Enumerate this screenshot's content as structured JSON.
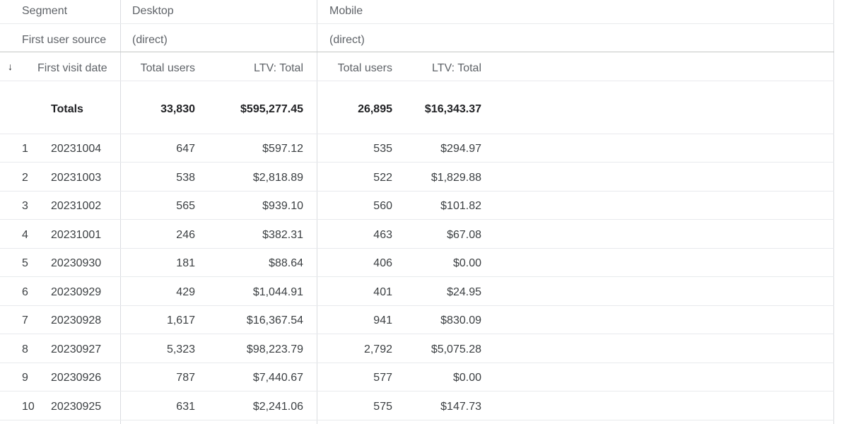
{
  "segment_row": {
    "label": "Segment",
    "desktop": "Desktop",
    "mobile": "Mobile"
  },
  "source_row": {
    "label": "First user source",
    "desktop": "(direct)",
    "mobile": "(direct)"
  },
  "header": {
    "sort_icon": "arrow-down-icon",
    "dimension": "First visit date",
    "desktop_users": "Total users",
    "desktop_ltv": "LTV: Total",
    "mobile_users": "Total users",
    "mobile_ltv": "LTV: Total"
  },
  "totals": {
    "label": "Totals",
    "desktop_users": "33,830",
    "desktop_ltv": "$595,277.45",
    "mobile_users": "26,895",
    "mobile_ltv": "$16,343.37"
  },
  "rows": [
    {
      "idx": "1",
      "date": "20231004",
      "d_users": "647",
      "d_ltv": "$597.12",
      "m_users": "535",
      "m_ltv": "$294.97"
    },
    {
      "idx": "2",
      "date": "20231003",
      "d_users": "538",
      "d_ltv": "$2,818.89",
      "m_users": "522",
      "m_ltv": "$1,829.88"
    },
    {
      "idx": "3",
      "date": "20231002",
      "d_users": "565",
      "d_ltv": "$939.10",
      "m_users": "560",
      "m_ltv": "$101.82"
    },
    {
      "idx": "4",
      "date": "20231001",
      "d_users": "246",
      "d_ltv": "$382.31",
      "m_users": "463",
      "m_ltv": "$67.08"
    },
    {
      "idx": "5",
      "date": "20230930",
      "d_users": "181",
      "d_ltv": "$88.64",
      "m_users": "406",
      "m_ltv": "$0.00"
    },
    {
      "idx": "6",
      "date": "20230929",
      "d_users": "429",
      "d_ltv": "$1,044.91",
      "m_users": "401",
      "m_ltv": "$24.95"
    },
    {
      "idx": "7",
      "date": "20230928",
      "d_users": "1,617",
      "d_ltv": "$16,367.54",
      "m_users": "941",
      "m_ltv": "$830.09"
    },
    {
      "idx": "8",
      "date": "20230927",
      "d_users": "5,323",
      "d_ltv": "$98,223.79",
      "m_users": "2,792",
      "m_ltv": "$5,075.28"
    },
    {
      "idx": "9",
      "date": "20230926",
      "d_users": "787",
      "d_ltv": "$7,440.67",
      "m_users": "577",
      "m_ltv": "$0.00"
    },
    {
      "idx": "10",
      "date": "20230925",
      "d_users": "631",
      "d_ltv": "$2,241.06",
      "m_users": "575",
      "m_ltv": "$147.73"
    }
  ]
}
